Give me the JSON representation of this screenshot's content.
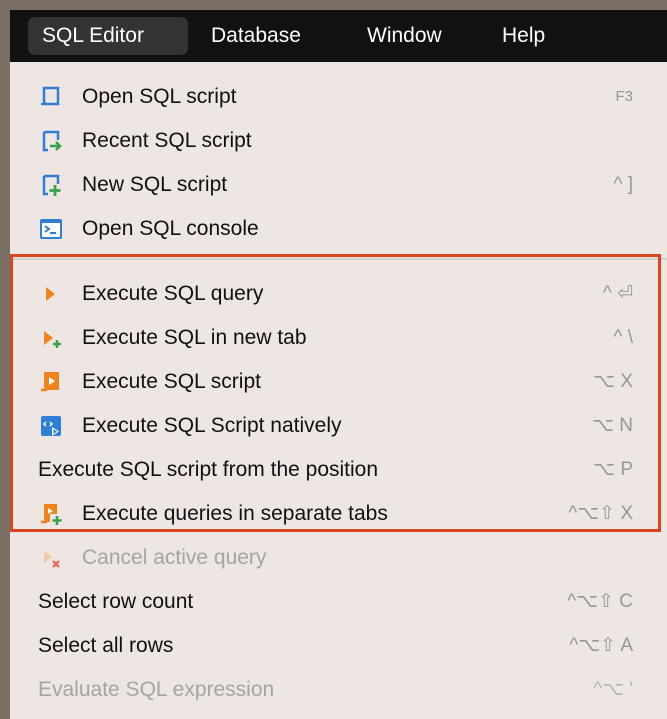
{
  "menubar": {
    "items": [
      "SQL Editor",
      "Database",
      "Window",
      "Help"
    ],
    "active_index": 0
  },
  "menu": {
    "group1": [
      {
        "label": "Open SQL script",
        "shortcut": "F3",
        "icon": "open-sql-script-icon"
      },
      {
        "label": "Recent SQL script",
        "shortcut": "",
        "icon": "recent-sql-script-icon"
      },
      {
        "label": "New SQL script",
        "shortcut": "^ ]",
        "icon": "new-sql-script-icon"
      },
      {
        "label": "Open SQL console",
        "shortcut": "",
        "icon": "sql-console-icon"
      }
    ],
    "group2": [
      {
        "label": "Execute SQL query",
        "shortcut": "^ ⏎",
        "icon": "play-icon"
      },
      {
        "label": "Execute SQL in new tab",
        "shortcut": "^ \\",
        "icon": "play-new-tab-icon"
      },
      {
        "label": "Execute SQL script",
        "shortcut": "⌥ X",
        "icon": "execute-script-icon"
      },
      {
        "label": "Execute SQL Script natively",
        "shortcut": "⌥ N",
        "icon": "execute-native-icon"
      },
      {
        "label": "Execute SQL script from the position",
        "shortcut": "⌥ P",
        "icon": ""
      },
      {
        "label": "Execute queries in separate tabs",
        "shortcut": "^⌥⇧ X",
        "icon": "execute-separate-tabs-icon"
      }
    ],
    "group3": [
      {
        "label": "Cancel active query",
        "shortcut": "",
        "icon": "cancel-query-icon",
        "disabled": true
      },
      {
        "label": "Select row count",
        "shortcut": "^⌥⇧ C",
        "icon": ""
      },
      {
        "label": "Select all rows",
        "shortcut": "^⌥⇧ A",
        "icon": ""
      },
      {
        "label": "Evaluate SQL expression",
        "shortcut": "^⌥ '",
        "icon": "",
        "disabled": true
      }
    ]
  },
  "colors": {
    "menubar_bg": "#111111",
    "active_menu_bg": "#333333",
    "panel_bg": "#ede6e3",
    "highlight_border": "#d9461f",
    "icon_blue": "#2f7fd6",
    "icon_orange": "#f0841c",
    "icon_green": "#36a34a"
  }
}
